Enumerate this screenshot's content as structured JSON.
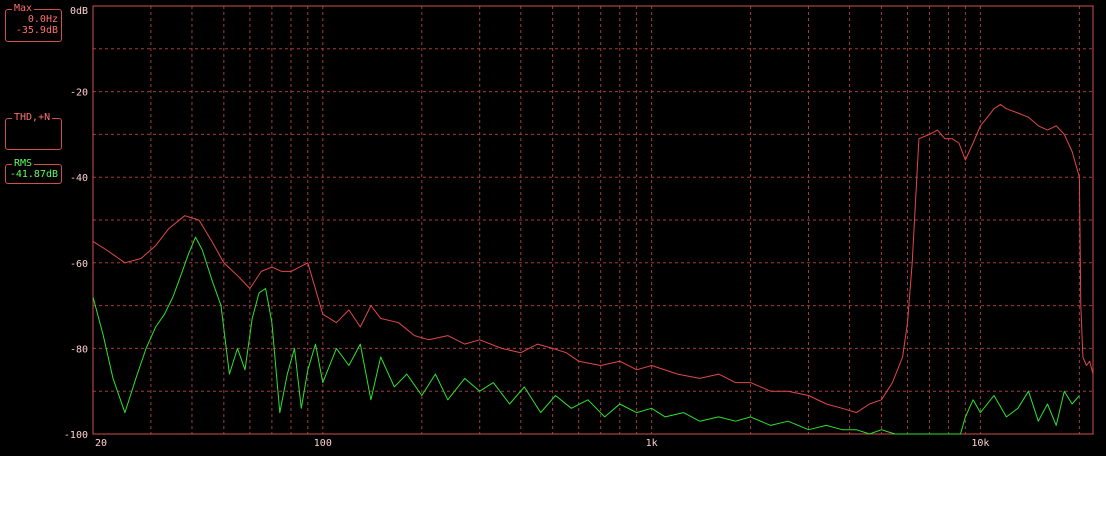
{
  "readouts": {
    "max": {
      "title": "Max",
      "freq": "0.0Hz",
      "level": "-35.9dB"
    },
    "thd": {
      "title": "THD,+N"
    },
    "rms": {
      "title": "RMS",
      "level": "-41.87dB"
    }
  },
  "colors": {
    "background": "#000000",
    "grid": "#a03c3c",
    "frame": "#d05050",
    "series_red": "#e04848",
    "series_green": "#30e030"
  },
  "chart_data": {
    "type": "line",
    "x_scale": "log",
    "xlim": [
      20,
      22000
    ],
    "ylim": [
      -100,
      0
    ],
    "grid": true,
    "y_ticks": [
      {
        "value": 0,
        "label": "0dB"
      },
      {
        "value": -20,
        "label": "-20"
      },
      {
        "value": -40,
        "label": "-40"
      },
      {
        "value": -60,
        "label": "-60"
      },
      {
        "value": -80,
        "label": "-80"
      },
      {
        "value": -100,
        "label": "-100"
      }
    ],
    "x_ticks": [
      {
        "value": 20,
        "label": "20"
      },
      {
        "value": 100,
        "label": "100"
      },
      {
        "value": 1000,
        "label": "1k"
      },
      {
        "value": 10000,
        "label": "10k"
      }
    ],
    "series": [
      {
        "color": "#e04848",
        "x": [
          20,
          22,
          25,
          28,
          31,
          34,
          38,
          42,
          46,
          50,
          55,
          60,
          65,
          70,
          75,
          80,
          85,
          90,
          100,
          110,
          120,
          130,
          140,
          150,
          170,
          190,
          210,
          240,
          270,
          300,
          350,
          400,
          450,
          500,
          550,
          600,
          700,
          800,
          900,
          1000,
          1200,
          1400,
          1600,
          1800,
          2000,
          2300,
          2600,
          3000,
          3400,
          3800,
          4200,
          4600,
          5000,
          5400,
          5800,
          6000,
          6200,
          6500,
          7000,
          7400,
          7800,
          8200,
          8600,
          9000,
          9500,
          10000,
          10500,
          11000,
          11500,
          12000,
          13000,
          14000,
          15000,
          16000,
          17000,
          18000,
          19000,
          20000,
          20200,
          20500,
          21000,
          21500,
          22000
        ],
        "y": [
          -55,
          -57,
          -60,
          -59,
          -56,
          -52,
          -49,
          -50,
          -55,
          -60,
          -63,
          -66,
          -62,
          -61,
          -62,
          -62,
          -61,
          -60,
          -72,
          -74,
          -71,
          -75,
          -70,
          -73,
          -74,
          -77,
          -78,
          -77,
          -79,
          -78,
          -80,
          -81,
          -79,
          -80,
          -81,
          -83,
          -84,
          -83,
          -85,
          -84,
          -86,
          -87,
          -86,
          -88,
          -88,
          -90,
          -90,
          -91,
          -93,
          -94,
          -95,
          -93,
          -92,
          -88,
          -82,
          -74,
          -60,
          -31,
          -30,
          -29,
          -31,
          -31,
          -32,
          -36,
          -32,
          -28,
          -26,
          -24,
          -23,
          -24,
          -25,
          -26,
          -28,
          -29,
          -28,
          -30,
          -34,
          -40,
          -70,
          -82,
          -84,
          -83,
          -86
        ]
      },
      {
        "color": "#30e030",
        "x": [
          20,
          21.5,
          23,
          25,
          27,
          29,
          31,
          33,
          35,
          37,
          39,
          41,
          43,
          46,
          49,
          52,
          55,
          58,
          61,
          64,
          67,
          70,
          74,
          78,
          82,
          86,
          90,
          95,
          100,
          110,
          120,
          130,
          140,
          150,
          165,
          180,
          200,
          220,
          240,
          270,
          300,
          330,
          370,
          410,
          460,
          510,
          570,
          640,
          720,
          800,
          900,
          1000,
          1100,
          1250,
          1400,
          1600,
          1800,
          2000,
          2300,
          2600,
          3000,
          3400,
          3800,
          4200,
          4600,
          5000,
          5500,
          6000,
          6500,
          7000,
          7600,
          8200,
          8700,
          9000,
          9500,
          10000,
          11000,
          12000,
          13000,
          14000,
          15000,
          16000,
          17000,
          18000,
          19000,
          20000
        ],
        "y": [
          -68,
          -77,
          -87,
          -95,
          -87,
          -80,
          -75,
          -72,
          -68,
          -63,
          -58,
          -54,
          -57,
          -64,
          -70,
          -86,
          -80,
          -85,
          -73,
          -67,
          -66,
          -74,
          -95,
          -86,
          -80,
          -94,
          -85,
          -79,
          -88,
          -80,
          -84,
          -79,
          -92,
          -82,
          -89,
          -86,
          -91,
          -86,
          -92,
          -87,
          -90,
          -88,
          -93,
          -89,
          -95,
          -91,
          -94,
          -92,
          -96,
          -93,
          -95,
          -94,
          -96,
          -95,
          -97,
          -96,
          -97,
          -96,
          -98,
          -97,
          -99,
          -98,
          -99,
          -99,
          -100,
          -99,
          -100,
          -100,
          -100,
          -100,
          -100,
          -100,
          -100,
          -96,
          -92,
          -95,
          -91,
          -96,
          -94,
          -90,
          -97,
          -93,
          -98,
          -90,
          -93,
          -91
        ]
      }
    ]
  }
}
